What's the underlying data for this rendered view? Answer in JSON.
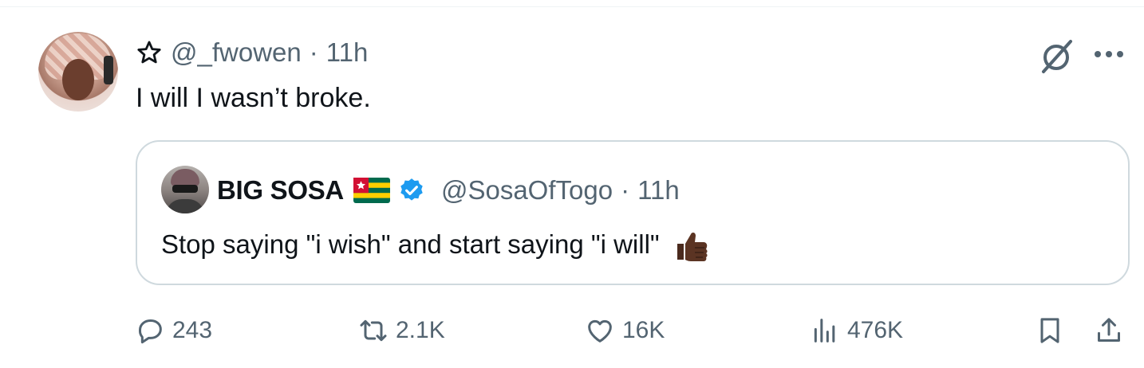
{
  "tweet": {
    "handle": "@_fwowen",
    "separator": "·",
    "time": "11h",
    "text": "I will I wasn’t broke."
  },
  "quote": {
    "name": "BIG SOSA",
    "handle": "@SosaOfTogo",
    "separator": "·",
    "time": "11h",
    "text": "Stop saying \"i wish\" and start saying \"i will\""
  },
  "actions": {
    "replies": "243",
    "reposts": "2.1K",
    "likes": "16K",
    "views": "476K"
  },
  "icons": {
    "header": [
      "star-icon",
      "grok-icon",
      "more-icon"
    ],
    "quote": [
      "togo-flag-icon",
      "verified-badge-icon",
      "thumbs-up-icon"
    ],
    "actions": [
      "reply-icon",
      "repost-icon",
      "like-icon",
      "views-icon",
      "bookmark-icon",
      "share-icon"
    ]
  },
  "colors": {
    "text": "#0f1419",
    "secondary": "#536471",
    "border": "#cfd9de",
    "verified": "#1d9bf0"
  }
}
